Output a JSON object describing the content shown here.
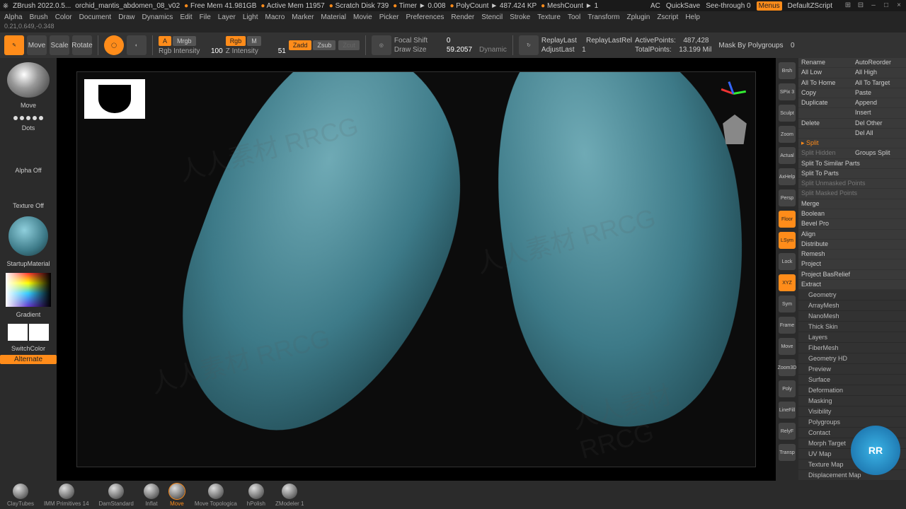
{
  "title": {
    "app": "ZBrush 2022.0.5...",
    "file": "orchid_mantis_abdomen_08_v02",
    "freemem": "Free Mem 41.981GB",
    "activemem": "Active Mem 11957",
    "scratch": "Scratch Disk 739",
    "timer": "Timer ► 0.008",
    "polycount": "PolyCount ► 487.424 KP",
    "meshcount": "MeshCount ► 1",
    "ac": "AC",
    "quicksave": "QuickSave",
    "seethru": "See-through 0",
    "menus": "Menus",
    "zscript": "DefaultZScript"
  },
  "menu": [
    "Alpha",
    "Brush",
    "Color",
    "Document",
    "Draw",
    "Dynamics",
    "Edit",
    "File",
    "Layer",
    "Light",
    "Macro",
    "Marker",
    "Material",
    "Movie",
    "Picker",
    "Preferences",
    "Render",
    "Stencil",
    "Stroke",
    "Texture",
    "Tool",
    "Transform",
    "Zplugin",
    "Zscript",
    "Help"
  ],
  "status": "0.21,0.649,-0.348",
  "tb": {
    "icons": [
      "Draw",
      "Move",
      "Scale",
      "Rotate"
    ],
    "modesA": {
      "A": "A",
      "Mrgb": "Mrgb"
    },
    "modesB": {
      "Rgb": "Rgb",
      "M": "M"
    },
    "modesC": {
      "Zadd": "Zadd",
      "Zsub": "Zsub"
    },
    "zcut": "Zcut",
    "sliders1": {
      "rgb_label": "Rgb Intensity",
      "rgb_val": "100",
      "z_label": "Z Intensity",
      "z_val": "51"
    },
    "sliders2": {
      "fs_label": "Focal Shift",
      "fs_val": "0",
      "ds_label": "Draw Size",
      "ds_val": "59.2057",
      "dyn": "Dynamic"
    },
    "replay": {
      "rl": "ReplayLast",
      "rlr": "ReplayLastRel",
      "al": "AdjustLast",
      "al_val": "1"
    },
    "points": {
      "ap_label": "ActivePoints:",
      "ap_val": "487,428",
      "tp_label": "TotalPoints:",
      "tp_val": "13.199 Mil"
    },
    "mask": {
      "label": "Mask By Polygroups",
      "val": "0"
    }
  },
  "left": {
    "brush": "Move",
    "stroke": "Dots",
    "alpha": "Alpha Off",
    "texture": "Texture Off",
    "material": "StartupMaterial",
    "gradient": "Gradient",
    "switch": "SwitchColor",
    "alt": "Alternate"
  },
  "righticons": [
    "Brsh",
    "SPix 3",
    "Sculpt",
    "Zoom",
    "Actual",
    "AxHelp",
    "Persp",
    "Floor",
    "LSym",
    "Lock",
    "XYZ",
    "Sym",
    "Frame",
    "Move",
    "Zoom3D",
    "Poly",
    "LineFill",
    "RelyF",
    "Transp"
  ],
  "rp": {
    "rows": [
      [
        "Rename",
        "AutoReorder"
      ],
      [
        "All Low",
        "All High"
      ],
      [
        "All To Home",
        "All To Target"
      ],
      [
        "Copy",
        "Paste"
      ],
      [
        "Duplicate",
        "Append"
      ],
      [
        "",
        "Insert"
      ],
      [
        "Delete",
        "Del Other"
      ],
      [
        "",
        "Del All"
      ]
    ],
    "split": "Split",
    "split2": [
      "Split Hidden",
      "Groups Split"
    ],
    "list": [
      "Split To Similar Parts",
      "Split To Parts",
      "Split Unmasked Points",
      "Split Masked Points",
      "Merge",
      "Boolean",
      "Bevel Pro",
      "Align",
      "Distribute",
      "Remesh",
      "Project",
      "Project BasRelief",
      "Extract"
    ],
    "subs": [
      "Geometry",
      "ArrayMesh",
      "NanoMesh",
      "Thick Skin",
      "Layers",
      "FiberMesh",
      "Geometry HD",
      "Preview",
      "Surface",
      "Deformation",
      "Masking",
      "Visibility",
      "Polygroups",
      "Contact",
      "Morph Target",
      "UV Map",
      "Texture Map",
      "Displacement Map"
    ]
  },
  "brushes": [
    {
      "name": "ClayTubes"
    },
    {
      "name": "IMM Primitives",
      "count": "14"
    },
    {
      "name": "DamStandard"
    },
    {
      "name": "Inflat"
    },
    {
      "name": "Move",
      "active": true
    },
    {
      "name": "Move Topologica"
    },
    {
      "name": "hPolish"
    },
    {
      "name": "ZModeler",
      "count": "1"
    }
  ],
  "badge": "RR",
  "watermark": "人人素材 RRCG"
}
